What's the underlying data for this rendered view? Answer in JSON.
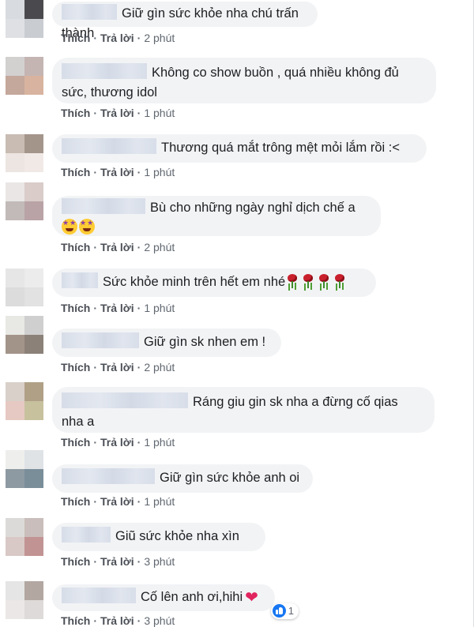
{
  "comments": [
    {
      "avatar_colors": [
        "#d8dbdf",
        "#4a4a4e",
        "#dee0e4",
        "#c9ccd1"
      ],
      "segments": [
        {
          "kind": "text",
          "text": "Giữ gìn sức khỏe nha chú trấn thành"
        }
      ],
      "actions": {
        "like": "Thích",
        "reply": "Trả lời",
        "time": "2 phút"
      }
    },
    {
      "avatar_colors": [
        "#d3d0d0",
        "#c4b5b2",
        "#c4a89c",
        "#d8b39f"
      ],
      "segments": [
        {
          "kind": "text",
          "text": "Không co show buồn , quá nhiều không đủ\nsức, thương idol"
        }
      ],
      "actions": {
        "like": "Thích",
        "reply": "Trả lời",
        "time": "1 phút"
      }
    },
    {
      "avatar_colors": [
        "#c8bcb3",
        "#a4958b",
        "#ece5e1",
        "#f1e9e6"
      ],
      "segments": [
        {
          "kind": "text",
          "text": "Thương quá mắt trông mệt mỏi lắm rồi :<"
        }
      ],
      "actions": {
        "like": "Thích",
        "reply": "Trả lời",
        "time": "1 phút"
      }
    },
    {
      "avatar_colors": [
        "#e9e6e5",
        "#d9ccc9",
        "#c2b9b9",
        "#b9a3a6"
      ],
      "segments": [
        {
          "kind": "text",
          "text": "Bù cho những ngày nghỉ dịch chế a\n"
        },
        {
          "kind": "emoji",
          "icon": "star-struck-emoji"
        },
        {
          "kind": "emoji",
          "icon": "star-struck-emoji"
        }
      ],
      "actions": {
        "like": "Thích",
        "reply": "Trả lời",
        "time": "2 phút"
      }
    },
    {
      "avatar_colors": [
        "#e6e6e6",
        "#ececec",
        "#dcdcdc",
        "#e2e2e2"
      ],
      "segments": [
        {
          "kind": "text",
          "text": "Sức khỏe minh trên hết em nhé"
        },
        {
          "kind": "emoji",
          "icon": "rose-emoji"
        },
        {
          "kind": "emoji",
          "icon": "rose-emoji"
        },
        {
          "kind": "emoji",
          "icon": "rose-emoji"
        },
        {
          "kind": "emoji",
          "icon": "rose-emoji"
        }
      ],
      "actions": {
        "like": "Thích",
        "reply": "Trả lời",
        "time": "1 phút"
      }
    },
    {
      "avatar_colors": [
        "#e8e8e4",
        "#cfcfcf",
        "#a39489",
        "#8b8179"
      ],
      "segments": [
        {
          "kind": "text",
          "text": "Giữ gìn sk nhen em !"
        }
      ],
      "actions": {
        "like": "Thích",
        "reply": "Trả lời",
        "time": "2 phút"
      }
    },
    {
      "avatar_colors": [
        "#d8d0c9",
        "#b0a086",
        "#e6c9c2",
        "#c7c19e"
      ],
      "segments": [
        {
          "kind": "text",
          "text": "Ráng giu gin sk nha a đừng cố qias\nnha a"
        }
      ],
      "actions": {
        "like": "Thích",
        "reply": "Trả lời",
        "time": "1 phút"
      }
    },
    {
      "avatar_colors": [
        "#eeeeec",
        "#dfe3e6",
        "#8e9aa2",
        "#7a8e9a"
      ],
      "segments": [
        {
          "kind": "text",
          "text": "Giữ gìn sức khỏe anh oi"
        }
      ],
      "actions": {
        "like": "Thích",
        "reply": "Trả lời",
        "time": "1 phút"
      }
    },
    {
      "avatar_colors": [
        "#dcdad8",
        "#c9bebb",
        "#d8c9c6",
        "#c29393"
      ],
      "segments": [
        {
          "kind": "text",
          "text": "Giũ sức khỏe nha xìn"
        }
      ],
      "actions": {
        "like": "Thích",
        "reply": "Trả lời",
        "time": "3 phút"
      }
    },
    {
      "avatar_colors": [
        "#e5e5e5",
        "#b2a7a1",
        "#eae7e6",
        "#dedad9"
      ],
      "segments": [
        {
          "kind": "text",
          "text": "Cố lên anh ơi,hihi"
        },
        {
          "kind": "emoji",
          "icon": "heart-emoji"
        }
      ],
      "actions": {
        "like": "Thích",
        "reply": "Trả lời",
        "time": "3 phút"
      },
      "reaction": {
        "icon": "like-reaction-icon",
        "count": "1"
      }
    }
  ],
  "colors": {
    "bubble": "#f2f3f5",
    "text": "#1c1e21",
    "action": "#4b4f56",
    "like_blue": "#1877f2",
    "heart": "#e0245e"
  }
}
